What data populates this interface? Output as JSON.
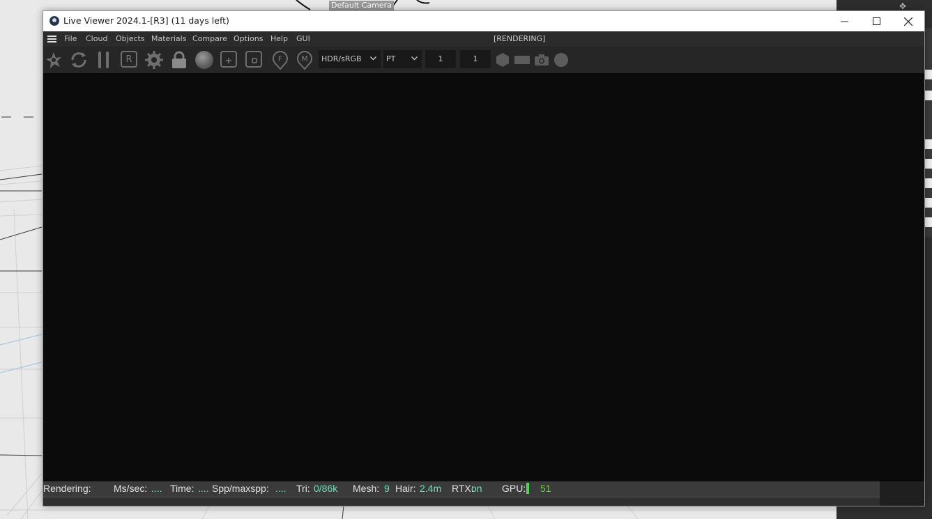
{
  "background": {
    "camera_label": "Default Camera"
  },
  "window": {
    "title": "Live Viewer 2024.1-[R3] (11 days left)",
    "controls": {
      "minimize": "—",
      "maximize": "☐",
      "close": "✕"
    }
  },
  "menu": {
    "items": [
      "File",
      "Cloud",
      "Objects",
      "Materials",
      "Compare",
      "Options",
      "Help",
      "GUI"
    ],
    "status": "[RENDERING]"
  },
  "toolbar": {
    "icons": [
      "clay-mode-icon",
      "restart-icon",
      "pause-icon",
      "region-icon",
      "settings-icon",
      "lock-icon",
      "material-ball-icon",
      "add-region-icon",
      "focus-region-icon",
      "focus-pick-icon",
      "material-pick-icon"
    ],
    "region_label": "R",
    "focus_label": "F",
    "material_label": "M",
    "color_space": "HDR/sRGB",
    "kernel": "PT",
    "value1": "1",
    "value2": "1"
  },
  "statusbar": {
    "rendering_label": "Rendering:",
    "mssec_label": "Ms/sec:",
    "mssec_value": "....",
    "time_label": "Time:",
    "time_value": "....",
    "spp_label": "Spp/maxspp:",
    "spp_value": "....",
    "tri_label": "Tri:",
    "tri_value": "0/86k",
    "mesh_label": "Mesh:",
    "mesh_value": "9",
    "hair_label": "Hair:",
    "hair_value": "2.4m",
    "rtx_label": "RTX:",
    "rtx_value": "on",
    "gpu_label": "GPU:",
    "gpu_value": "51"
  },
  "colors": {
    "accent_value": "#6fe0b8",
    "gpu_green": "#4bd65a"
  }
}
